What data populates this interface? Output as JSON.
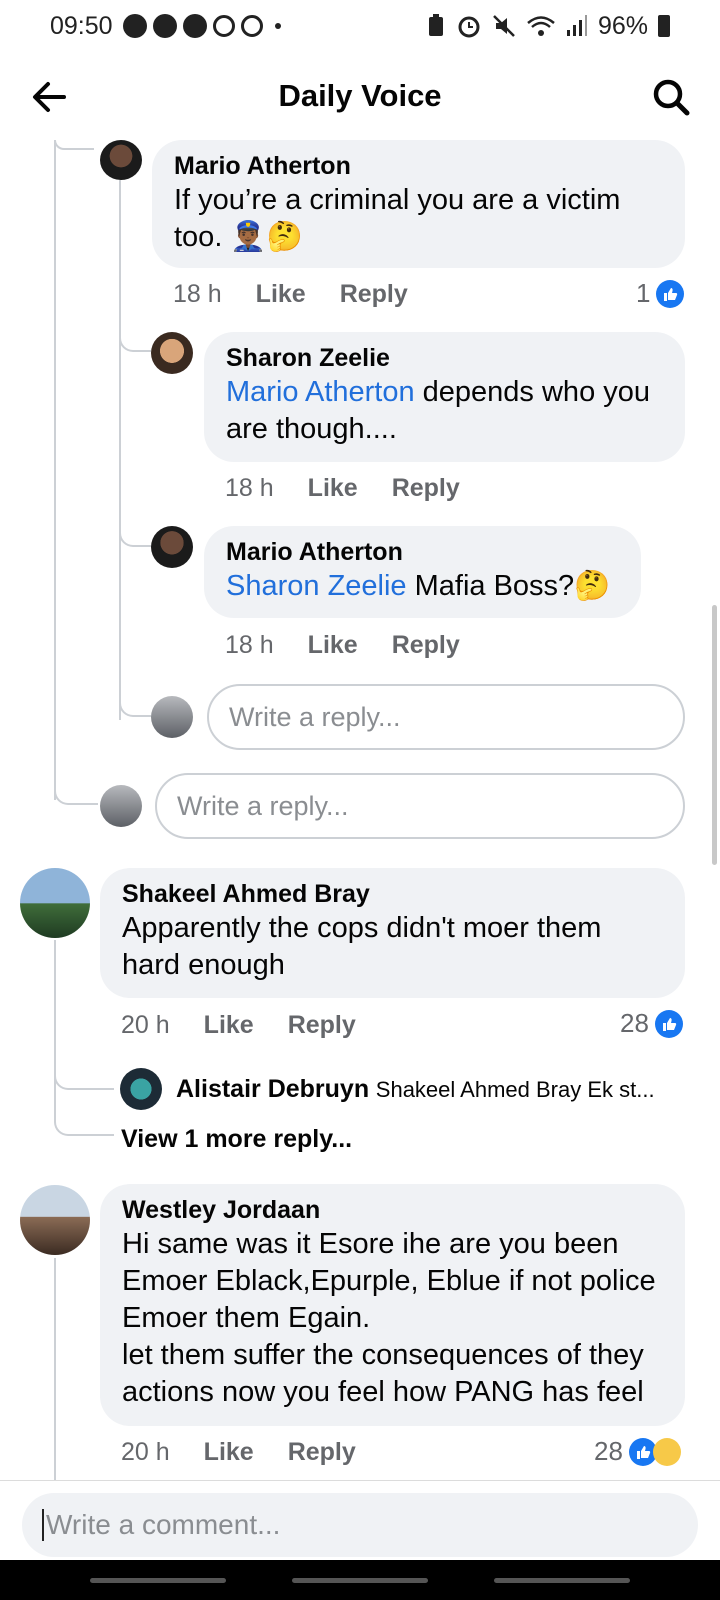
{
  "status_bar": {
    "time": "09:50",
    "battery": "96%",
    "icons": [
      "messenger-icon",
      "messenger-icon",
      "messenger-icon",
      "recycle-icon",
      "recycle-icon",
      "battery-saver-icon",
      "alarm-icon",
      "mute-icon",
      "wifi-icon",
      "signal-icon"
    ]
  },
  "header": {
    "title": "Daily Voice",
    "back_icon": "arrow-left-icon",
    "search_icon": "search-icon"
  },
  "thread": {
    "c1": {
      "author": "Mario Atherton",
      "text": "If you’re a criminal you are a victim too. 👮🏾‍♂️🤔",
      "time": "18 h",
      "like": "Like",
      "reply": "Reply",
      "reactions": "1"
    },
    "c2": {
      "author": "Sharon Zeelie",
      "mention": "Mario Atherton",
      "text": " depends who you are though....",
      "time": "18 h",
      "like": "Like",
      "reply": "Reply"
    },
    "c3": {
      "author": "Mario Atherton",
      "mention": "Sharon Zeelie",
      "text": " Mafia Boss?🤔",
      "time": "18 h",
      "like": "Like",
      "reply": "Reply"
    },
    "reply_placeholder_inner": "Write a reply...",
    "reply_placeholder_outer": "Write a reply..."
  },
  "comment2": {
    "author": "Shakeel Ahmed Bray",
    "text": "Apparently the cops didn't moer them hard enough",
    "time": "20 h",
    "like": "Like",
    "reply": "Reply",
    "reactions": "28",
    "preview_author": "Alistair Debruyn",
    "preview_text": "Shakeel Ahmed Bray Ek st...",
    "view_more": "View 1 more reply..."
  },
  "comment3": {
    "author": "Westley Jordaan",
    "text": "Hi same was it Esore ihe are you been Emoer Eblack,Epurple, Eblue if not police Emoer them Egain.\nlet them suffer the consequences of they actions now you feel how PANG has feel",
    "time": "20 h",
    "like": "Like",
    "reply": "Reply",
    "reactions": "28"
  },
  "composer": {
    "placeholder": "Write a comment..."
  },
  "colors": {
    "accent": "#1877f2",
    "mention": "#216fdb",
    "bubble": "#f0f2f5",
    "meta": "#65676b"
  }
}
